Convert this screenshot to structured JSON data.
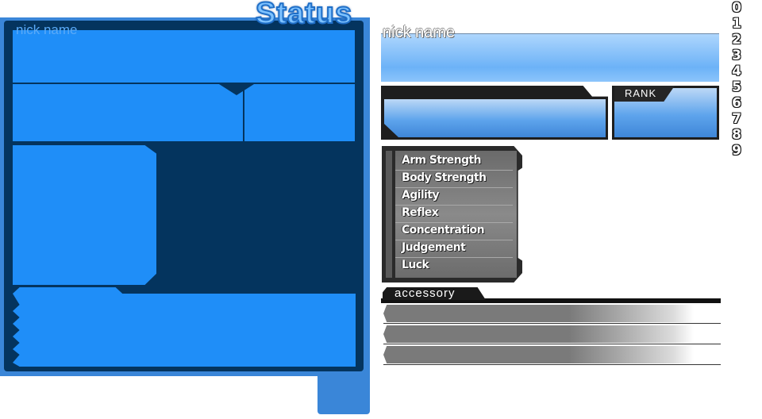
{
  "left_panel": {
    "title": "Status",
    "nick_label": "nick name"
  },
  "profile": {
    "nick_label": "nick name",
    "rank_label": "RANK"
  },
  "stats": [
    {
      "label": "Arm Strength"
    },
    {
      "label": "Body Strength"
    },
    {
      "label": "Agility"
    },
    {
      "label": "Reflex"
    },
    {
      "label": "Concentration"
    },
    {
      "label": "Judgement"
    },
    {
      "label": "Luck"
    }
  ],
  "accessory": {
    "label": "accessory",
    "slots": 3
  },
  "digits": [
    "0",
    "1",
    "2",
    "3",
    "4",
    "5",
    "6",
    "7",
    "8",
    "9"
  ],
  "colors": {
    "panel_blue": "#1f8ef8",
    "panel_frame": "#04345e",
    "title_blue": "#7ec2ff",
    "stat_gray": "#7a7a7a"
  }
}
